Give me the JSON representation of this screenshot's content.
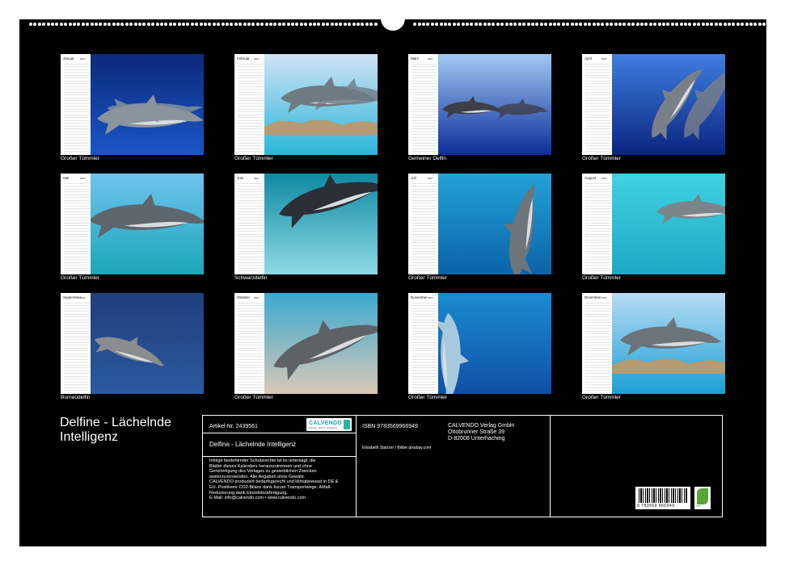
{
  "document": {
    "title": "Delfine - Lächelnde Intelligenz"
  },
  "months": [
    {
      "name": "Januar",
      "year": "2027",
      "caption": "Großer Tümmler",
      "bg": [
        "#0b2a7a",
        "#1a56c7"
      ],
      "dolphin": "#8a949c"
    },
    {
      "name": "Februar",
      "year": "2027",
      "caption": "Großer Tümmler",
      "bg": [
        "#cfe3f5",
        "#2ab6d8"
      ],
      "dolphin": "#6f7a82"
    },
    {
      "name": "März",
      "year": "2027",
      "caption": "Gemeiner Delfin",
      "bg": [
        "#9fc9f2",
        "#0d2d9a"
      ],
      "dolphin": "#3d3f48"
    },
    {
      "name": "April",
      "year": "2027",
      "caption": "Großer Tümmler",
      "bg": [
        "#3e7fe0",
        "#0a2480"
      ],
      "dolphin": "#7a8088"
    },
    {
      "name": "Mai",
      "year": "2027",
      "caption": "Großer Tümmler",
      "bg": [
        "#6fc2ef",
        "#1ba7b7"
      ],
      "dolphin": "#5e666d"
    },
    {
      "name": "Juni",
      "year": "2027",
      "caption": "Schwarzdelfin",
      "bg": [
        "#0e8aa1",
        "#8ed9e5"
      ],
      "dolphin": "#2b3038"
    },
    {
      "name": "Juli",
      "year": "2027",
      "caption": "Großer Tümmler",
      "bg": [
        "#23a2d6",
        "#0b63a8"
      ],
      "dolphin": "#6d747a"
    },
    {
      "name": "August",
      "year": "2027",
      "caption": "Großer Tümmler",
      "bg": [
        "#3fd3e3",
        "#1ea8c4"
      ],
      "dolphin": "#7b8589"
    },
    {
      "name": "September",
      "year": "2027",
      "caption": "Borneodelfin",
      "bg": [
        "#1f3f7d",
        "#2c5aa0"
      ],
      "dolphin": "#8a8c90"
    },
    {
      "name": "Oktober",
      "year": "2027",
      "caption": "Großer Tümmler",
      "bg": [
        "#3aa9d0",
        "#d9c8b6"
      ],
      "dolphin": "#5c6266"
    },
    {
      "name": "November",
      "year": "2027",
      "caption": "Großer Tümmler",
      "bg": [
        "#1b8cd1",
        "#0f4fa6"
      ],
      "dolphin": "#a7c9de"
    },
    {
      "name": "Dezember",
      "year": "2027",
      "caption": "Großer Tümmler",
      "bg": [
        "#b7dcf5",
        "#1c9fd2"
      ],
      "dolphin": "#6b747b"
    }
  ],
  "info": {
    "article": "Artikel-Nr. 2439561",
    "logo_text": "CALVENDO",
    "logo_sub": "Kalender - Bücher - Wandkunst",
    "product_title": "Delfine - Lächelnde Intelligenz",
    "legal_text": [
      "Infolge bestehender Schutzrechte ist es untersagt, die",
      "Blätter dieses Kalenders herauszutrennen und ohne",
      "Genehmigung des Verlages zu gewerblichen Zwecken",
      "weiterzuverwenden. Alle Angaben ohne Gewähr.",
      "CALVENDO produziert bedarfsgerecht und klimabewusst in DE &",
      "EU. Positivere CO2-Bilanz dank kurzer Transportwege. Abfall-",
      "Reduzierung dank Einzelstückfertigung.",
      "E-Mail: info@calvendo.com • www.calvendo.com"
    ],
    "isbn": "ISBN 9783569966949",
    "publisher": [
      "CALVENDO Verlag GmbH",
      "Ottobrunner Straße 39",
      "D-82008 Unterhaching"
    ],
    "credits": "Elisabeth Stanzer / Bilder pixabay.com",
    "barcode_number": "9 783569 966949",
    "eco_label": "eco"
  }
}
